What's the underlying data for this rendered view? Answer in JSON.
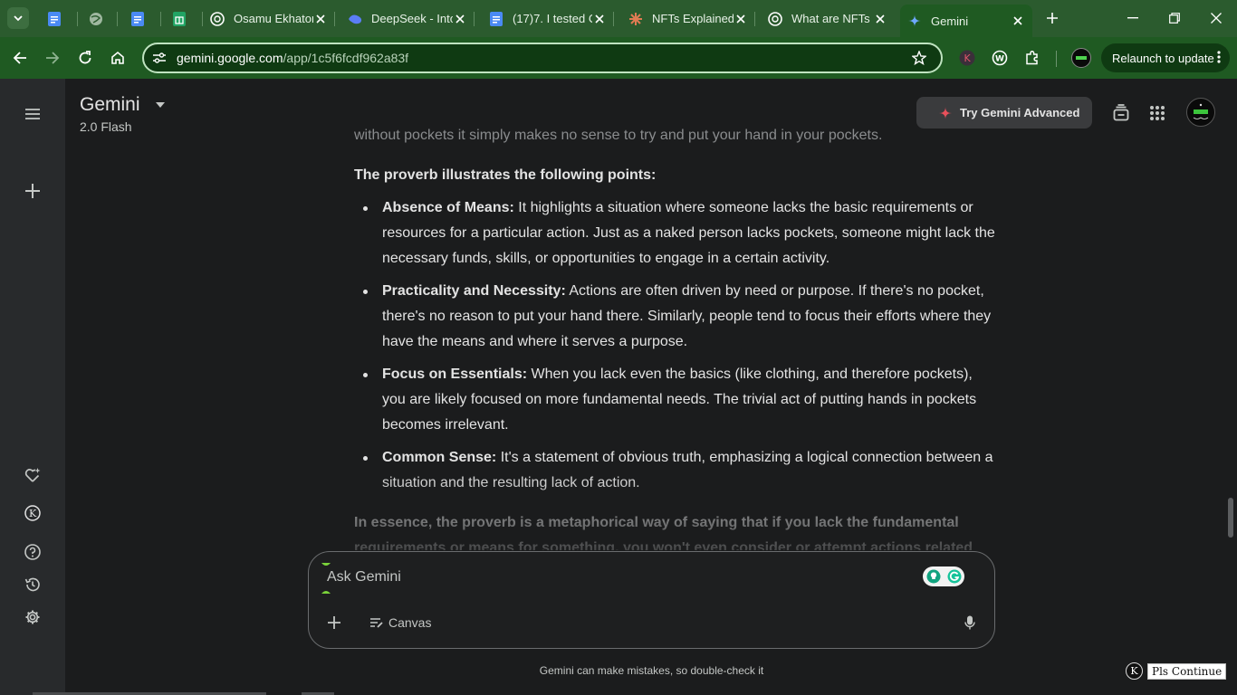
{
  "browser": {
    "tabs": [
      {
        "title": "",
        "icon": "docs-icon"
      },
      {
        "title": "",
        "icon": "globe-icon"
      },
      {
        "title": "",
        "icon": "docs-icon"
      },
      {
        "title": "",
        "icon": "sheets-icon"
      },
      {
        "title": "Osamu Ekhator",
        "icon": "openai-icon"
      },
      {
        "title": "DeepSeek - Into",
        "icon": "deepseek-icon"
      },
      {
        "title": "(17)7. I tested C",
        "icon": "docs-icon"
      },
      {
        "title": "NFTs Explained",
        "icon": "claude-icon"
      },
      {
        "title": "What are NFTs",
        "icon": "openai-icon"
      },
      {
        "title": "Gemini",
        "icon": "gemini-icon",
        "active": true
      }
    ],
    "url_host": "gemini.google.com",
    "url_path": "/app/1c5f6fcdf962a83f",
    "relaunch_label": "Relaunch to update"
  },
  "header": {
    "title": "Gemini",
    "model": "2.0 Flash",
    "try_advanced": "Try Gemini Advanced"
  },
  "conversation": {
    "cut_text": "without pockets it simply makes no sense to try and put your hand in your pockets.",
    "lead": "The proverb illustrates the following points:",
    "points": [
      {
        "term": "Absence of Means:",
        "text": " It highlights a situation where someone lacks the basic requirements or resources for a particular action. Just as a naked person lacks pockets, someone might lack the necessary funds, skills, or opportunities to engage in a certain activity."
      },
      {
        "term": "Practicality and Necessity:",
        "text": " Actions are often driven by need or purpose. If there's no pocket, there's no reason to put your hand there. Similarly, people tend to focus their efforts where they have the means and where it serves a purpose."
      },
      {
        "term": "Focus on Essentials:",
        "text": " When you lack even the basics (like clothing, and therefore pockets), you are likely focused on more fundamental needs. The trivial act of putting hands in pockets becomes irrelevant."
      },
      {
        "term": "Common Sense:",
        "text": " It's a statement of obvious truth, emphasizing a logical connection between a situation and the resulting lack of action."
      }
    ],
    "essence": "In essence, the proverb is a metaphorical way of saying that if you lack the fundamental requirements or means for something, you won't even consider or attempt actions related"
  },
  "input": {
    "placeholder": "Ask Gemini",
    "canvas_label": "Canvas"
  },
  "disclaimer": "Gemini can make mistakes, so double-check it",
  "extension_label": "Pls Continue",
  "colors": {
    "tab_strip": "#2b5b2e",
    "toolbar": "#1f5a22",
    "page_bg": "#1b1c1d",
    "sidebar_bg": "#282a2c"
  }
}
